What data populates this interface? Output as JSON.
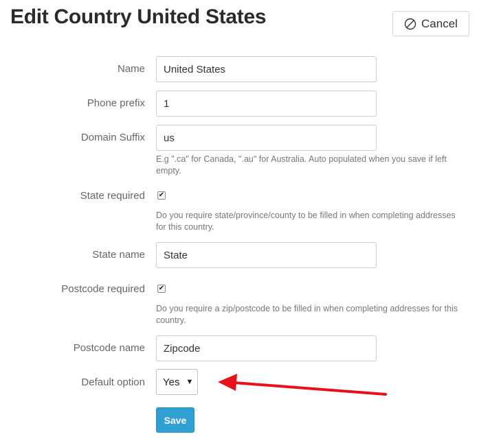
{
  "header": {
    "title": "Edit Country United States",
    "cancel_label": "Cancel",
    "cancel_icon": "ban-icon"
  },
  "form": {
    "name": {
      "label": "Name",
      "value": "United States"
    },
    "phone_prefix": {
      "label": "Phone prefix",
      "value": "1"
    },
    "domain_suffix": {
      "label": "Domain Suffix",
      "value": "us",
      "help": "E.g \".ca\" for Canada, \".au\" for Australia. Auto populated when you save if left empty."
    },
    "state_required": {
      "label": "State required",
      "checked": true,
      "help": "Do you require state/province/county to be filled in when completing addresses for this country."
    },
    "state_name": {
      "label": "State name",
      "value": "State"
    },
    "postcode_required": {
      "label": "Postcode required",
      "checked": true,
      "help": "Do you require a zip/postcode to be filled in when completing addresses for this country."
    },
    "postcode_name": {
      "label": "Postcode name",
      "value": "Zipcode"
    },
    "default_option": {
      "label": "Default option",
      "value": "Yes"
    },
    "save_label": "Save"
  },
  "annotation": {
    "arrow_color": "#e8101a"
  }
}
